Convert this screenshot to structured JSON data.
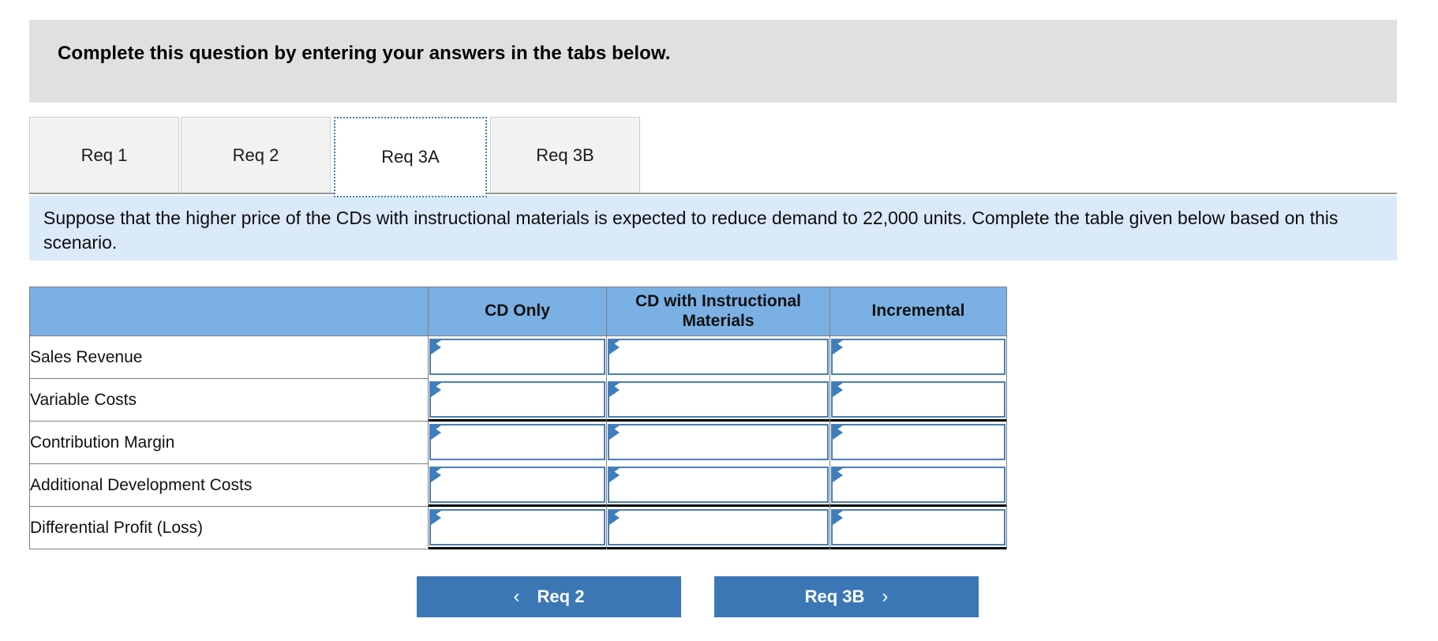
{
  "banner": {
    "instruction": "Complete this question by entering your answers in the tabs below."
  },
  "tabs": [
    {
      "label": "Req 1",
      "active": false
    },
    {
      "label": "Req 2",
      "active": false
    },
    {
      "label": "Req 3A",
      "active": true
    },
    {
      "label": "Req 3B",
      "active": false
    }
  ],
  "scenario": {
    "text": "Suppose that the higher price of the CDs with instructional materials is expected to reduce demand to 22,000 units. Complete the table given below based on this scenario."
  },
  "table": {
    "headers": [
      "",
      "CD Only",
      "CD with Instructional Materials",
      "Incremental"
    ],
    "rows": [
      {
        "label": "Sales Revenue",
        "values": [
          "",
          "",
          ""
        ]
      },
      {
        "label": "Variable Costs",
        "values": [
          "",
          "",
          ""
        ]
      },
      {
        "label": "Contribution Margin",
        "values": [
          "",
          "",
          ""
        ]
      },
      {
        "label": "Additional Development Costs",
        "values": [
          "",
          "",
          ""
        ]
      },
      {
        "label": "Differential Profit (Loss)",
        "values": [
          "",
          "",
          ""
        ]
      }
    ]
  },
  "footer": {
    "prev_label": "Req 2",
    "next_label": "Req 3B",
    "prev_icon": "chevron-left-icon",
    "next_icon": "chevron-right-icon",
    "prev_chevron": "‹",
    "next_chevron": "›"
  },
  "colors": {
    "banner_bg": "#e0e0e0",
    "scenario_bg": "#dbeafa",
    "table_header_bg": "#7bb0e4",
    "button_bg": "#3b77b5",
    "input_border": "#4a7fb5",
    "focus_outline": "#3d7ebd"
  }
}
